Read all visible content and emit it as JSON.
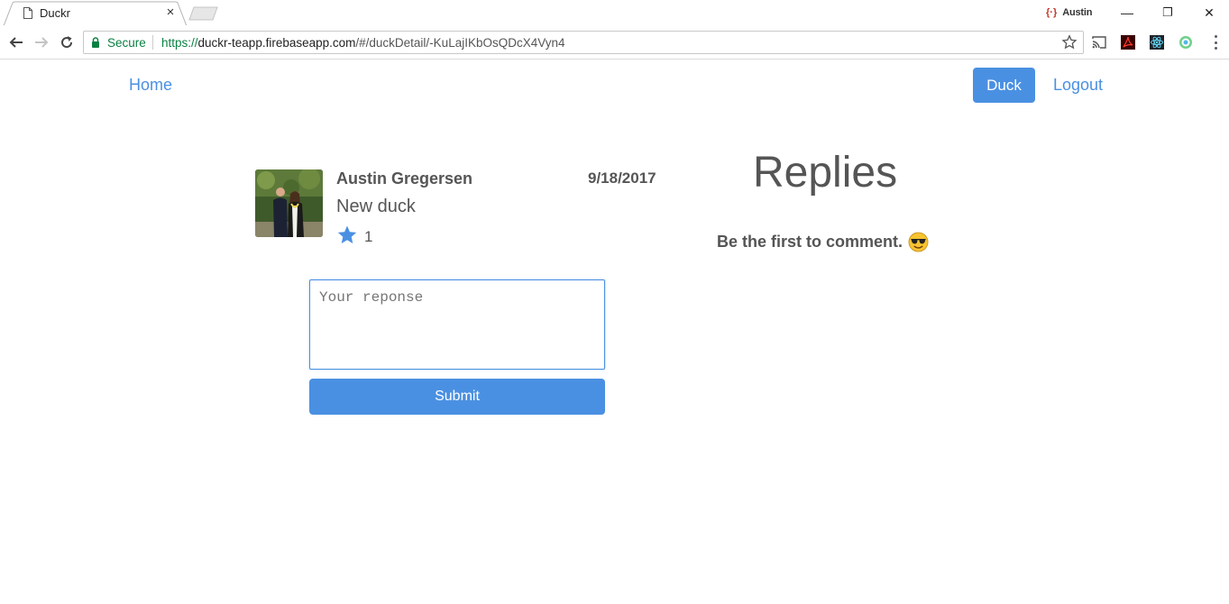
{
  "browser": {
    "tab_title": "Duckr",
    "tab_close": "×",
    "profile_name": "Austin",
    "secure_label": "Secure",
    "url_scheme": "https://",
    "url_host": "duckr-teapp.firebaseapp.com",
    "url_path": "/#/duckDetail/-KuLajIKbOsQDcX4Vyn4",
    "window_controls": {
      "minimize": "—",
      "restore": "❐",
      "close": "✕"
    }
  },
  "nav": {
    "home_label": "Home",
    "duck_label": "Duck",
    "logout_label": "Logout"
  },
  "duck": {
    "author": "Austin Gregersen",
    "date": "9/18/2017",
    "text": "New duck",
    "like_count": "1",
    "icon": "star-icon"
  },
  "response_form": {
    "placeholder": "Your reponse",
    "value": "",
    "submit_label": "Submit"
  },
  "replies": {
    "title": "Replies",
    "empty_text": "Be the first to comment.",
    "empty_emoji": "sunglasses-emoji-icon"
  },
  "colors": {
    "accent": "#4a90e2",
    "text": "#555555",
    "secure_green": "#0b8043"
  }
}
